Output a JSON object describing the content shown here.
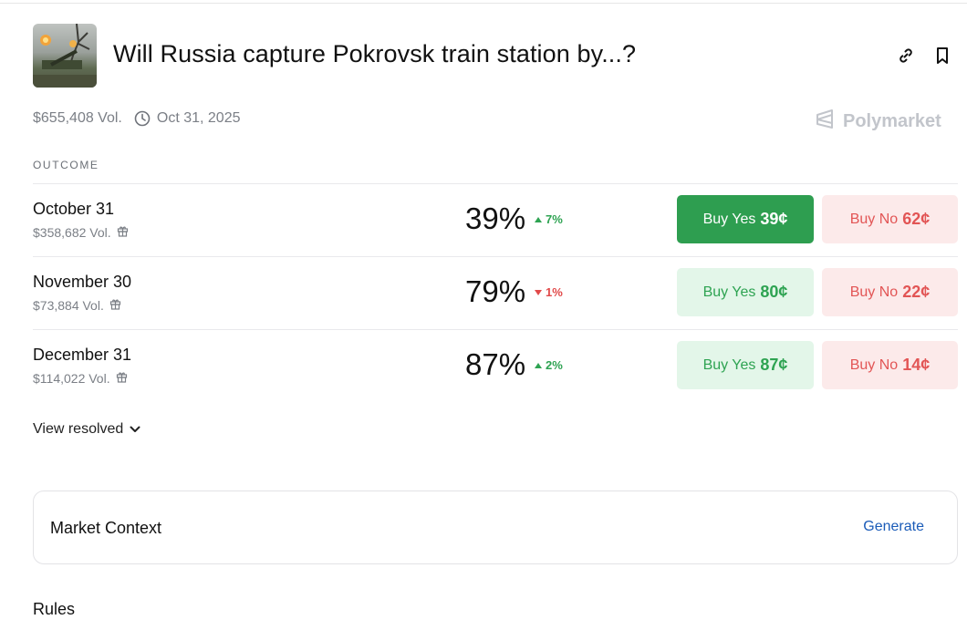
{
  "header": {
    "title": "Will Russia capture Pokrovsk train station by...?",
    "volume": "$655,408 Vol.",
    "end_date": "Oct 31, 2025",
    "brand": "Polymarket"
  },
  "table": {
    "column_header": "OUTCOME",
    "rows": [
      {
        "name": "October 31",
        "volume": "$358,682 Vol.",
        "percent": "39%",
        "change": "7%",
        "direction": "up",
        "yes_label": "Buy Yes",
        "yes_price": "39¢",
        "no_label": "Buy No",
        "no_price": "62¢"
      },
      {
        "name": "November 30",
        "volume": "$73,884 Vol.",
        "percent": "79%",
        "change": "1%",
        "direction": "down",
        "yes_label": "Buy Yes",
        "yes_price": "80¢",
        "no_label": "Buy No",
        "no_price": "22¢"
      },
      {
        "name": "December 31",
        "volume": "$114,022 Vol.",
        "percent": "87%",
        "change": "2%",
        "direction": "up",
        "yes_label": "Buy Yes",
        "yes_price": "87¢",
        "no_label": "Buy No",
        "no_price": "14¢"
      }
    ]
  },
  "view_resolved": "View resolved",
  "market_context": {
    "label": "Market Context",
    "action": "Generate"
  },
  "rules_heading": "Rules",
  "colors": {
    "green": "#2e9e50",
    "red": "#e25555",
    "link_blue": "#1a5bb8"
  },
  "icons": [
    "link-icon",
    "bookmark-icon",
    "clock-icon",
    "polymarket-logo-icon",
    "gift-icon",
    "caret-up-icon",
    "caret-down-icon",
    "chevron-down-icon"
  ]
}
